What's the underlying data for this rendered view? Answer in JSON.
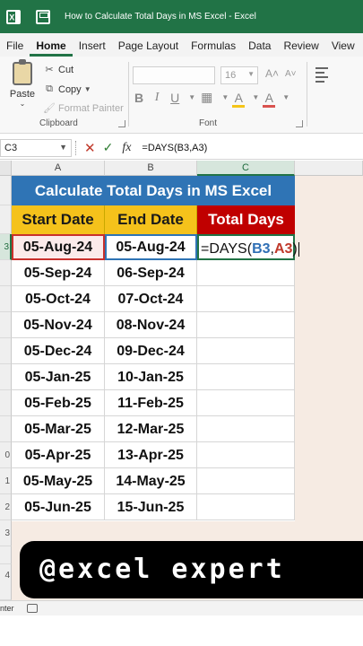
{
  "app": {
    "title": "How to Calculate Total Days in MS Excel  -  Excel",
    "accent_color": "#217346"
  },
  "menu": {
    "tabs": [
      "File",
      "Home",
      "Insert",
      "Page Layout",
      "Formulas",
      "Data",
      "Review",
      "View"
    ],
    "active": "Home"
  },
  "ribbon": {
    "clipboard": {
      "paste": "Paste",
      "cut": "Cut",
      "copy": "Copy",
      "format_painter": "Format Painter",
      "label": "Clipboard"
    },
    "font": {
      "size": "16",
      "label": "Font",
      "bold": "B",
      "italic": "I",
      "underline": "U",
      "grow": "A˄",
      "shrink": "A˅",
      "fill": "A",
      "font_color": "A"
    }
  },
  "formula_bar": {
    "name_box": "C3",
    "cancel": "✕",
    "enter": "✓",
    "fx": "fx",
    "formula": "=DAYS(B3,A3)"
  },
  "grid": {
    "columns": [
      "A",
      "B",
      "C"
    ],
    "rows": [
      "",
      "",
      "3",
      "",
      "",
      "",
      "",
      "",
      "",
      "",
      "0",
      "1",
      "2",
      "3",
      "",
      "4"
    ],
    "title": "Calculate Total Days in MS Excel",
    "headers": [
      "Start Date",
      "End Date",
      "Total Days"
    ],
    "data": [
      {
        "start": "05-Aug-24",
        "end": "05-Aug-24"
      },
      {
        "start": "05-Sep-24",
        "end": "06-Sep-24"
      },
      {
        "start": "05-Oct-24",
        "end": "07-Oct-24"
      },
      {
        "start": "05-Nov-24",
        "end": "08-Nov-24"
      },
      {
        "start": "05-Dec-24",
        "end": "09-Dec-24"
      },
      {
        "start": "05-Jan-25",
        "end": "10-Jan-25"
      },
      {
        "start": "05-Feb-25",
        "end": "11-Feb-25"
      },
      {
        "start": "05-Mar-25",
        "end": "12-Mar-25"
      },
      {
        "start": "05-Apr-25",
        "end": "13-Apr-25"
      },
      {
        "start": "05-May-25",
        "end": "14-May-25"
      },
      {
        "start": "05-Jun-25",
        "end": "15-Jun-25"
      }
    ],
    "editing_cell": {
      "prefix": "=DAYS(",
      "ref1": "B3",
      "comma": ",",
      "ref2": "A3",
      "suffix": ")"
    }
  },
  "banner": {
    "text": "@excel expert"
  },
  "status": {
    "mode": "nter"
  }
}
